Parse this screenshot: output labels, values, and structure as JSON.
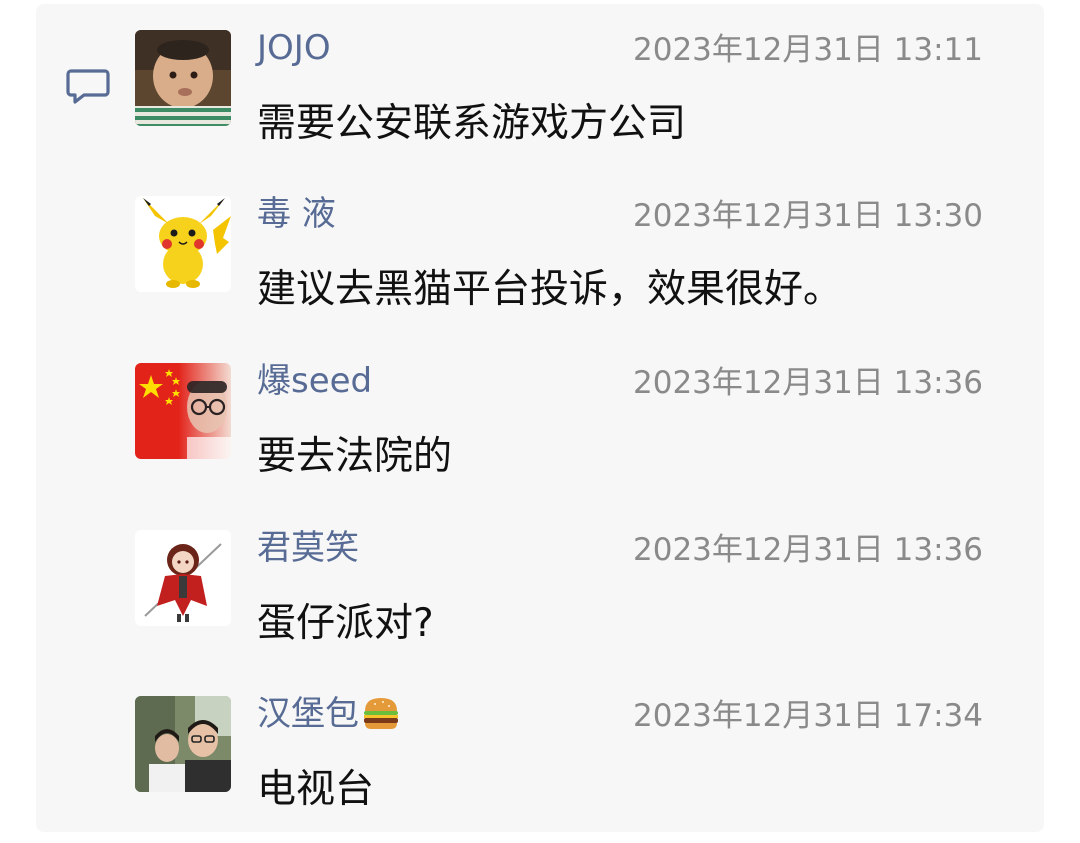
{
  "comments": [
    {
      "name": "JOJO",
      "time": "2023年12月31日 13:11",
      "text": "需要公安联系游戏方公司",
      "avatar": "baby-avatar"
    },
    {
      "name": "毒 液",
      "time": "2023年12月31日 13:30",
      "text": "建议去黑猫平台投诉，效果很好。",
      "avatar": "pikachu-avatar"
    },
    {
      "name": "爆seed",
      "time": "2023年12月31日 13:36",
      "text": "要去法院的",
      "avatar": "flag-person-avatar"
    },
    {
      "name": "君莫笑",
      "time": "2023年12月31日 13:36",
      "text": "蛋仔派对?",
      "avatar": "anime-warrior-avatar"
    },
    {
      "name": "汉堡包",
      "time": "2023年12月31日 17:34",
      "text": "电视台",
      "avatar": "couple-photo-avatar",
      "name_icon": "hamburger-icon"
    }
  ],
  "icons": {
    "comment": "speech-bubble-icon"
  },
  "colors": {
    "name": "#576b95",
    "time": "#8a8a8a",
    "text": "#111111",
    "panel_background": "#f7f7f7"
  }
}
